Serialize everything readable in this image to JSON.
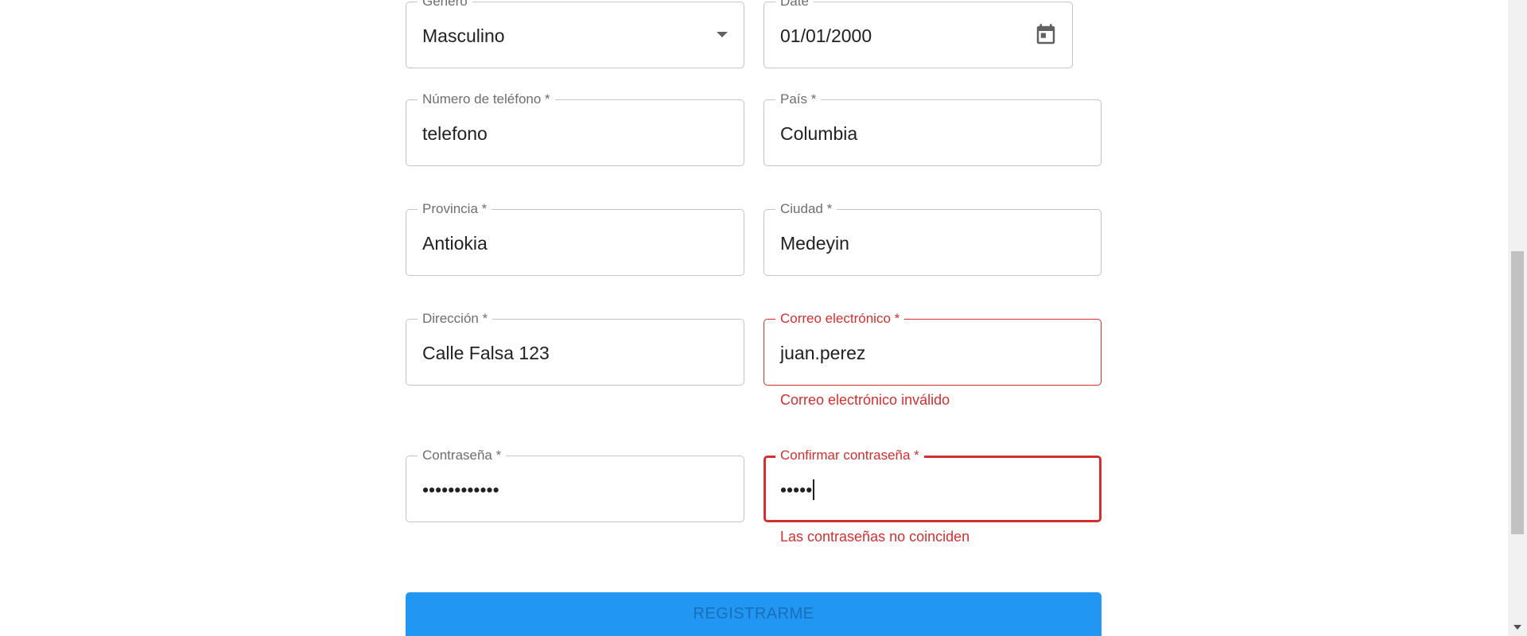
{
  "fields": {
    "genero": {
      "label": "Genero",
      "value": "Masculino"
    },
    "date": {
      "label": "Date",
      "value": "01/01/2000"
    },
    "telefono": {
      "label": "Número de teléfono *",
      "value": "telefono"
    },
    "pais": {
      "label": "País *",
      "value": "Columbia"
    },
    "provincia": {
      "label": "Provincia *",
      "value": "Antiokia"
    },
    "ciudad": {
      "label": "Ciudad *",
      "value": "Medeyin"
    },
    "direccion": {
      "label": "Dirección *",
      "value": "Calle Falsa 123"
    },
    "correo": {
      "label": "Correo electrónico *",
      "value": "juan.perez",
      "error": "Correo electrónico inválido"
    },
    "contrasena": {
      "label": "Contraseña *",
      "value": "••••••••••••"
    },
    "confirmar": {
      "label": "Confirmar contraseña *",
      "value": "•••••",
      "error": "Las contraseñas no coinciden"
    }
  },
  "submit_label": "REGISTRARME",
  "colors": {
    "primary": "#2196f3",
    "error": "#d32f2f",
    "border": "#c4c4c4"
  },
  "icons": {
    "genero": "chevron-down-icon",
    "date": "calendar-icon"
  }
}
